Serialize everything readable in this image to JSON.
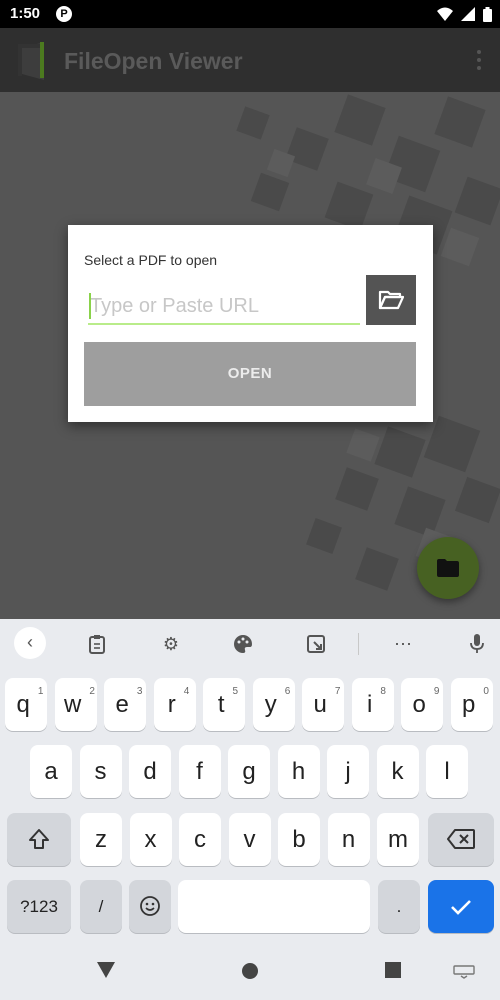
{
  "status_bar": {
    "time": "1:50",
    "app_badge": "P",
    "icons": [
      "wifi-icon",
      "signal-icon",
      "battery-icon"
    ]
  },
  "app_bar": {
    "title": "FileOpen Viewer",
    "menu_icon": "overflow-menu-icon"
  },
  "dialog": {
    "label": "Select a PDF to open",
    "url_placeholder": "Type or Paste URL",
    "url_value": "",
    "browse_icon": "folder-open-icon",
    "open_label": "OPEN"
  },
  "fab": {
    "icon": "folder-icon"
  },
  "keyboard": {
    "toolbar": [
      "back-icon",
      "clipboard-icon",
      "gear-icon",
      "palette-icon",
      "resize-icon",
      "more-icon",
      "mic-icon"
    ],
    "row1": [
      {
        "k": "q",
        "h": "1"
      },
      {
        "k": "w",
        "h": "2"
      },
      {
        "k": "e",
        "h": "3"
      },
      {
        "k": "r",
        "h": "4"
      },
      {
        "k": "t",
        "h": "5"
      },
      {
        "k": "y",
        "h": "6"
      },
      {
        "k": "u",
        "h": "7"
      },
      {
        "k": "i",
        "h": "8"
      },
      {
        "k": "o",
        "h": "9"
      },
      {
        "k": "p",
        "h": "0"
      }
    ],
    "row2": [
      "a",
      "s",
      "d",
      "f",
      "g",
      "h",
      "j",
      "k",
      "l"
    ],
    "row3": [
      "z",
      "x",
      "c",
      "v",
      "b",
      "n",
      "m"
    ],
    "symbols_label": "?123",
    "slash_label": "/",
    "period_label": ".",
    "emoji_icon": "emoji-icon",
    "enter_icon": "check-icon",
    "shift_icon": "shift-icon",
    "backspace_icon": "backspace-icon"
  },
  "nav_bar": {
    "icons": [
      "back-triangle-icon",
      "home-circle-icon",
      "recents-square-icon",
      "keyboard-switch-icon"
    ]
  },
  "colors": {
    "accent_green": "#476122",
    "input_underline": "#b9ec8a",
    "enter_blue": "#1a73e8"
  }
}
